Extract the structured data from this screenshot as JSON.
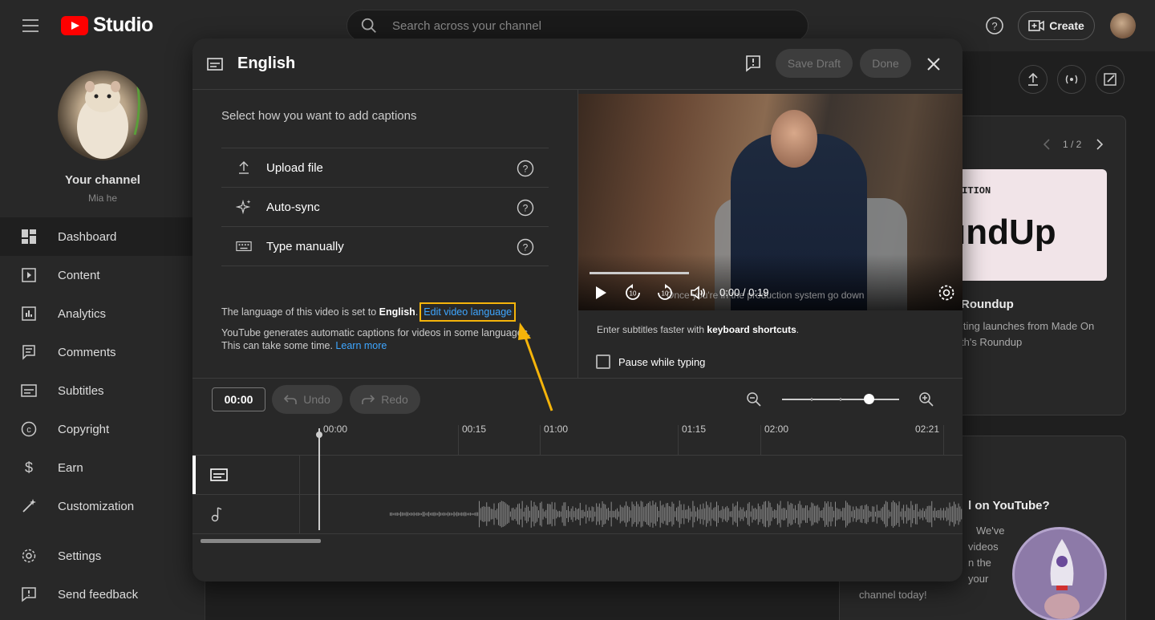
{
  "topbar": {
    "logo_text": "Studio",
    "search_placeholder": "Search across your channel",
    "create_label": "Create"
  },
  "sidebar": {
    "channel_title": "Your channel",
    "channel_name": "Mia he",
    "items": [
      {
        "label": "Dashboard",
        "icon": "dashboard-icon",
        "active": true
      },
      {
        "label": "Content",
        "icon": "content-icon"
      },
      {
        "label": "Analytics",
        "icon": "analytics-icon"
      },
      {
        "label": "Comments",
        "icon": "comments-icon"
      },
      {
        "label": "Subtitles",
        "icon": "subtitles-icon"
      },
      {
        "label": "Copyright",
        "icon": "copyright-icon"
      },
      {
        "label": "Earn",
        "icon": "earn-icon"
      },
      {
        "label": "Customization",
        "icon": "customization-icon"
      }
    ],
    "bottom_items": [
      {
        "label": "Settings",
        "icon": "gear-icon"
      },
      {
        "label": "Send feedback",
        "icon": "feedback-icon"
      }
    ]
  },
  "background": {
    "pager": "1 / 2",
    "card_title_fragment": "Roundup",
    "card_text_1": "iting launches from Made On",
    "card_text_2": "th's Roundup",
    "thumb_text_top": "DITION",
    "thumb_text_big": "ındUp",
    "card2_title_fragment": "l on YouTube?",
    "card2_lines": [
      "We've",
      "videos",
      "n the",
      "your"
    ],
    "card2_last": "channel today!"
  },
  "modal": {
    "title": "English",
    "save_draft_label": "Save Draft",
    "done_label": "Done",
    "prompt": "Select how you want to add captions",
    "options": [
      {
        "label": "Upload file",
        "icon": "upload-icon"
      },
      {
        "label": "Auto-sync",
        "icon": "sparkle-icon"
      },
      {
        "label": "Type manually",
        "icon": "keyboard-icon"
      }
    ],
    "lang_prefix": "The language of this video is set to ",
    "lang_value": "English",
    "lang_period": ".",
    "edit_language_link": "Edit video language",
    "generate_text": "YouTube generates automatic captions for videos in some languages. This can take some time. ",
    "learn_more": "Learn more",
    "video_time": "0:00 / 0:19",
    "video_caption": "Once you're in the production system go down",
    "shortcut_prefix": "Enter subtitles faster with ",
    "shortcut_bold": "keyboard shortcuts",
    "shortcut_suffix": ".",
    "pause_label": "Pause while typing",
    "pause_checked": false
  },
  "timeline": {
    "current_time": "00:00",
    "undo_label": "Undo",
    "redo_label": "Redo",
    "ticks": [
      "00:00",
      "00:15",
      "01:00",
      "01:15",
      "02:00",
      "02:21"
    ]
  },
  "colors": {
    "accent_link": "#3ea6ff",
    "highlight_box": "#f5b40a",
    "brand_red": "#ff0000"
  }
}
